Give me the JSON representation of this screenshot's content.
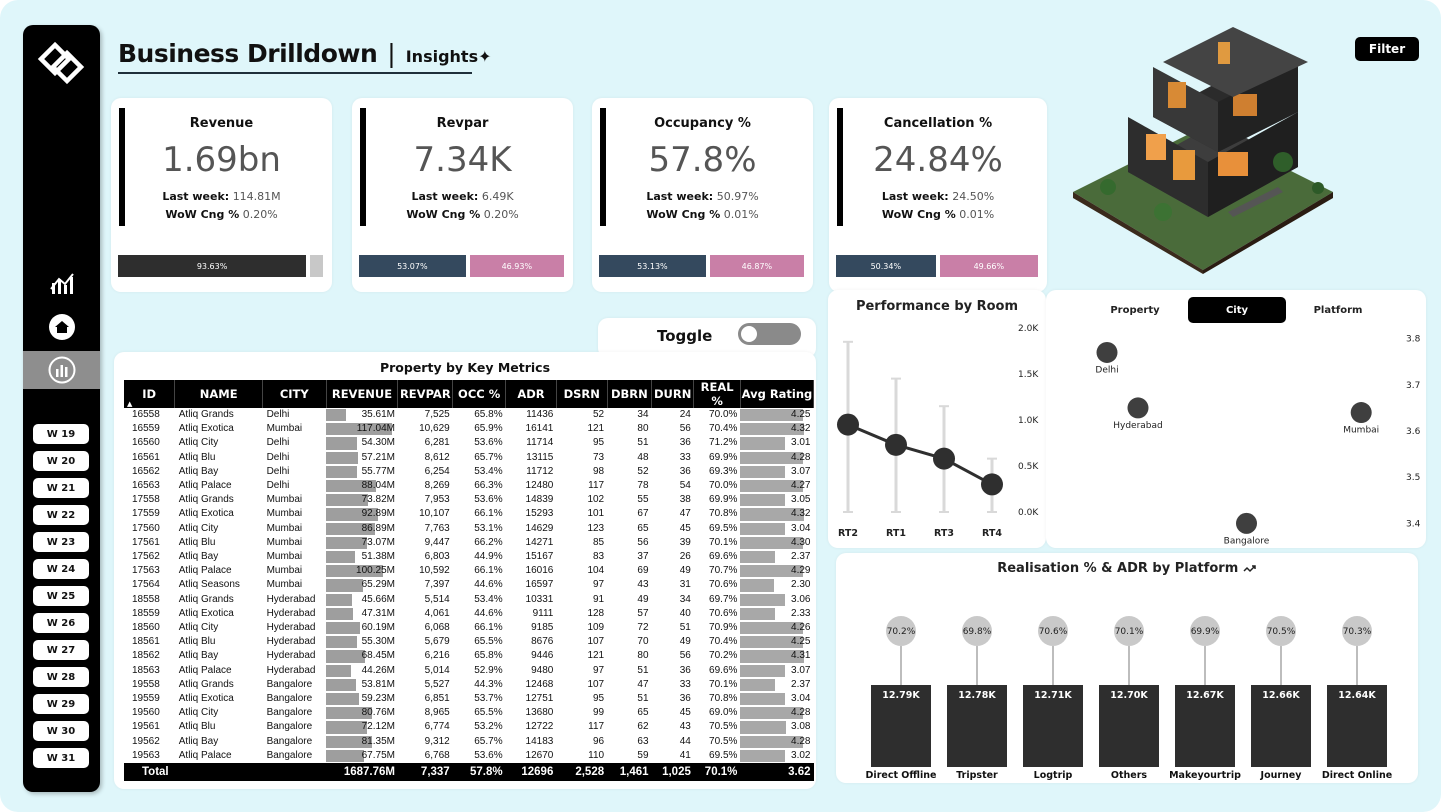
{
  "title": {
    "main": "Business Drilldown",
    "separator": "|",
    "sub": "Insights✦"
  },
  "filter_label": "Filter",
  "sidebar": {
    "weeks": [
      "W 19",
      "W 20",
      "W 21",
      "W 22",
      "W 23",
      "W 24",
      "W 25",
      "W 26",
      "W 27",
      "W 28",
      "W 29",
      "W 30",
      "W 31"
    ]
  },
  "kpis": [
    {
      "label": "Revenue",
      "value": "1.69bn",
      "last_week_label": "Last week:",
      "last_week": "114.81M",
      "wow_label": "WoW Cng %",
      "wow": "0.20%",
      "segments": [
        {
          "pct": "93.63%",
          "share": 0.9363,
          "color": "#2e2e2e"
        },
        {
          "pct": "",
          "share": 0.0637,
          "color": "#c8c8c8"
        }
      ]
    },
    {
      "label": "Revpar",
      "value": "7.34K",
      "last_week_label": "Last week:",
      "last_week": "6.49K",
      "wow_label": "WoW Cng %",
      "wow": "0.20%",
      "segments": [
        {
          "pct": "53.07%",
          "share": 0.5307,
          "color": "#34495e"
        },
        {
          "pct": "46.93%",
          "share": 0.4693,
          "color": "#c97fa7"
        }
      ]
    },
    {
      "label": "Occupancy %",
      "value": "57.8%",
      "last_week_label": "Last week:",
      "last_week": "50.97%",
      "wow_label": "WoW Cng %",
      "wow": "0.01%",
      "segments": [
        {
          "pct": "53.13%",
          "share": 0.5313,
          "color": "#34495e"
        },
        {
          "pct": "46.87%",
          "share": 0.4687,
          "color": "#c97fa7"
        }
      ]
    },
    {
      "label": "Cancellation %",
      "value": "24.84%",
      "last_week_label": "Last week:",
      "last_week": "24.50%",
      "wow_label": "WoW Cng %",
      "wow": "0.01%",
      "segments": [
        {
          "pct": "50.34%",
          "share": 0.5034,
          "color": "#34495e"
        },
        {
          "pct": "49.66%",
          "share": 0.4966,
          "color": "#c97fa7"
        }
      ]
    }
  ],
  "toggle": {
    "label": "Toggle",
    "on": false
  },
  "table": {
    "title": "Property by Key Metrics",
    "columns": [
      "ID",
      "NAME",
      "CITY",
      "REVENUE",
      "REVPAR",
      "OCC %",
      "ADR",
      "DSRN",
      "DBRN",
      "DURN",
      "REAL %",
      "Avg Rating"
    ],
    "rows": [
      [
        "16558",
        "Atliq Grands",
        "Delhi",
        "35.61M",
        "7,525",
        "65.8%",
        "11436",
        "52",
        "34",
        "24",
        "70.0%",
        "4.25"
      ],
      [
        "16559",
        "Atliq Exotica",
        "Mumbai",
        "117.04M",
        "10,629",
        "65.9%",
        "16141",
        "121",
        "80",
        "56",
        "70.4%",
        "4.32"
      ],
      [
        "16560",
        "Atliq City",
        "Delhi",
        "54.30M",
        "6,281",
        "53.6%",
        "11714",
        "95",
        "51",
        "36",
        "71.2%",
        "3.01"
      ],
      [
        "16561",
        "Atliq Blu",
        "Delhi",
        "57.21M",
        "8,612",
        "65.7%",
        "13115",
        "73",
        "48",
        "33",
        "69.9%",
        "4.28"
      ],
      [
        "16562",
        "Atliq Bay",
        "Delhi",
        "55.77M",
        "6,254",
        "53.4%",
        "11712",
        "98",
        "52",
        "36",
        "69.3%",
        "3.07"
      ],
      [
        "16563",
        "Atliq Palace",
        "Delhi",
        "88.04M",
        "8,269",
        "66.3%",
        "12480",
        "117",
        "78",
        "54",
        "70.0%",
        "4.27"
      ],
      [
        "17558",
        "Atliq Grands",
        "Mumbai",
        "73.82M",
        "7,953",
        "53.6%",
        "14839",
        "102",
        "55",
        "38",
        "69.9%",
        "3.05"
      ],
      [
        "17559",
        "Atliq Exotica",
        "Mumbai",
        "92.89M",
        "10,107",
        "66.1%",
        "15293",
        "101",
        "67",
        "47",
        "70.8%",
        "4.32"
      ],
      [
        "17560",
        "Atliq City",
        "Mumbai",
        "86.89M",
        "7,763",
        "53.1%",
        "14629",
        "123",
        "65",
        "45",
        "69.5%",
        "3.04"
      ],
      [
        "17561",
        "Atliq Blu",
        "Mumbai",
        "73.07M",
        "9,447",
        "66.2%",
        "14271",
        "85",
        "56",
        "39",
        "70.1%",
        "4.30"
      ],
      [
        "17562",
        "Atliq Bay",
        "Mumbai",
        "51.38M",
        "6,803",
        "44.9%",
        "15167",
        "83",
        "37",
        "26",
        "69.6%",
        "2.37"
      ],
      [
        "17563",
        "Atliq Palace",
        "Mumbai",
        "100.25M",
        "10,592",
        "66.1%",
        "16016",
        "104",
        "69",
        "49",
        "70.7%",
        "4.29"
      ],
      [
        "17564",
        "Atliq Seasons",
        "Mumbai",
        "65.29M",
        "7,397",
        "44.6%",
        "16597",
        "97",
        "43",
        "31",
        "70.6%",
        "2.30"
      ],
      [
        "18558",
        "Atliq Grands",
        "Hyderabad",
        "45.66M",
        "5,514",
        "53.4%",
        "10331",
        "91",
        "49",
        "34",
        "69.7%",
        "3.06"
      ],
      [
        "18559",
        "Atliq Exotica",
        "Hyderabad",
        "47.31M",
        "4,061",
        "44.6%",
        "9111",
        "128",
        "57",
        "40",
        "70.6%",
        "2.33"
      ],
      [
        "18560",
        "Atliq City",
        "Hyderabad",
        "60.19M",
        "6,068",
        "66.1%",
        "9185",
        "109",
        "72",
        "51",
        "70.9%",
        "4.26"
      ],
      [
        "18561",
        "Atliq Blu",
        "Hyderabad",
        "55.30M",
        "5,679",
        "65.5%",
        "8676",
        "107",
        "70",
        "49",
        "70.4%",
        "4.25"
      ],
      [
        "18562",
        "Atliq Bay",
        "Hyderabad",
        "68.45M",
        "6,216",
        "65.8%",
        "9446",
        "121",
        "80",
        "56",
        "70.2%",
        "4.31"
      ],
      [
        "18563",
        "Atliq Palace",
        "Hyderabad",
        "44.26M",
        "5,014",
        "52.9%",
        "9480",
        "97",
        "51",
        "36",
        "69.6%",
        "3.07"
      ],
      [
        "19558",
        "Atliq Grands",
        "Bangalore",
        "53.81M",
        "5,527",
        "44.3%",
        "12468",
        "107",
        "47",
        "33",
        "70.1%",
        "2.37"
      ],
      [
        "19559",
        "Atliq Exotica",
        "Bangalore",
        "59.23M",
        "6,851",
        "53.7%",
        "12751",
        "95",
        "51",
        "36",
        "70.8%",
        "3.04"
      ],
      [
        "19560",
        "Atliq City",
        "Bangalore",
        "80.76M",
        "8,965",
        "65.5%",
        "13680",
        "99",
        "65",
        "45",
        "69.0%",
        "4.28"
      ],
      [
        "19561",
        "Atliq Blu",
        "Bangalore",
        "72.12M",
        "6,774",
        "53.2%",
        "12722",
        "117",
        "62",
        "43",
        "70.5%",
        "3.08"
      ],
      [
        "19562",
        "Atliq Bay",
        "Bangalore",
        "81.35M",
        "9,312",
        "65.7%",
        "14183",
        "96",
        "63",
        "44",
        "70.5%",
        "4.28"
      ],
      [
        "19563",
        "Atliq Palace",
        "Bangalore",
        "67.75M",
        "6,768",
        "53.6%",
        "12670",
        "110",
        "59",
        "41",
        "69.5%",
        "3.02"
      ]
    ],
    "total": [
      "Total",
      "",
      "",
      "1687.76M",
      "7,337",
      "57.8%",
      "12696",
      "2,528",
      "1,461",
      "1,025",
      "70.1%",
      "3.62"
    ]
  },
  "chart_data": [
    {
      "type": "line",
      "title": "Performance by Room",
      "categories": [
        "RT2",
        "RT1",
        "RT3",
        "RT4"
      ],
      "values": [
        0.95,
        0.73,
        0.58,
        0.3
      ],
      "range_high": [
        1.85,
        1.45,
        1.15,
        0.58
      ],
      "range_low": [
        0,
        0,
        0,
        0
      ],
      "y_ticks": [
        "0.0K",
        "0.5K",
        "1.0K",
        "1.5K",
        "2.0K"
      ],
      "ylim": [
        0,
        2.0
      ]
    },
    {
      "type": "scatter",
      "tabs": [
        "Property",
        "City",
        "Platform"
      ],
      "active_tab": "City",
      "points": [
        {
          "label": "Delhi",
          "x": 0.1,
          "y": 3.77
        },
        {
          "label": "Hyderabad",
          "x": 0.2,
          "y": 3.65
        },
        {
          "label": "Mumbai",
          "x": 0.92,
          "y": 3.64
        },
        {
          "label": "Bangalore",
          "x": 0.55,
          "y": 3.4
        }
      ],
      "y_ticks": [
        "3.4",
        "3.5",
        "3.6",
        "3.7",
        "3.8"
      ],
      "ylim": [
        3.39,
        3.81
      ]
    },
    {
      "type": "bar",
      "title": "Realisation % & ADR by Platform",
      "title_icon": "trend-icon",
      "categories": [
        "Direct Offline",
        "Tripster",
        "Logtrip",
        "Others",
        "Makeyourtrip",
        "Journey",
        "Direct Online"
      ],
      "adr_labels": [
        "12.79K",
        "12.78K",
        "12.71K",
        "12.70K",
        "12.67K",
        "12.66K",
        "12.64K"
      ],
      "realisation_labels": [
        "70.2%",
        "69.8%",
        "70.6%",
        "70.1%",
        "69.9%",
        "70.5%",
        "70.3%"
      ]
    }
  ]
}
